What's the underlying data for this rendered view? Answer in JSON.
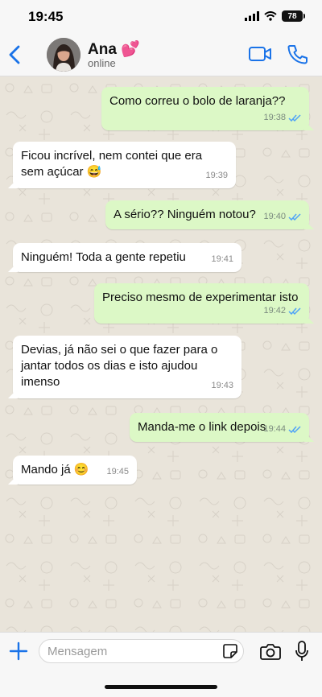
{
  "status_bar": {
    "time": "19:45",
    "battery": "78"
  },
  "header": {
    "contact_name": "Ana 💕",
    "contact_status": "online"
  },
  "messages": [
    {
      "direction": "out",
      "text": "Como correu o bolo de laranja??",
      "time": "19:38",
      "read": true
    },
    {
      "direction": "in",
      "text": [
        "Ficou incrível, nem contei que era",
        "sem açúcar 😅"
      ],
      "time": "19:39"
    },
    {
      "direction": "out",
      "text": "A sério?? Ninguém notou?",
      "time": "19:40",
      "read": true
    },
    {
      "direction": "in",
      "text": "Ninguém! Toda a gente repetiu",
      "time": "19:41"
    },
    {
      "direction": "out",
      "text": "Preciso mesmo de experimentar isto",
      "time": "19:42",
      "read": true
    },
    {
      "direction": "in",
      "text": [
        "Devias, já não sei o que fazer para o",
        "jantar todos os dias e isto ajudou",
        "imenso"
      ],
      "time": "19:43"
    },
    {
      "direction": "out",
      "text": "Manda-me o link depois",
      "time": "19:44",
      "read": true
    },
    {
      "direction": "in",
      "text": "Mando já 😊",
      "time": "19:45"
    }
  ],
  "input": {
    "placeholder": "Mensagem",
    "value": ""
  },
  "colors": {
    "accent": "#1a73e8",
    "outgoing_bubble": "#dcf8c6",
    "incoming_bubble": "#ffffff",
    "chat_background": "#e9e4da"
  }
}
